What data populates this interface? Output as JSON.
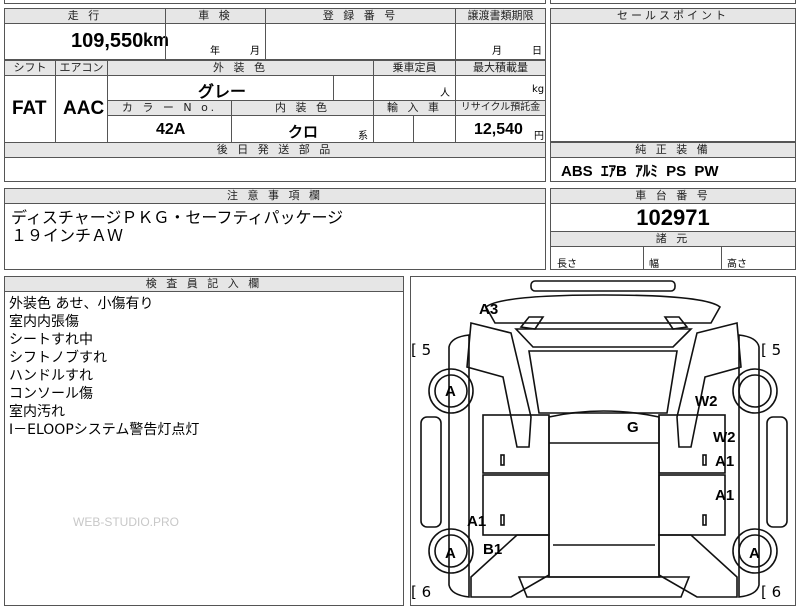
{
  "top_section": {
    "headers": {
      "mileage": "走 行",
      "inspection": "車 検",
      "registration": "登 録 番 号",
      "transfer_deadline": "譲渡書類期限",
      "sales_point": "セールスポイント"
    },
    "mileage_value": "109,550",
    "mileage_unit": "km",
    "inspection_year": "年",
    "inspection_month": "月",
    "transfer_month": "月",
    "transfer_day": "日"
  },
  "spec_section": {
    "headers": {
      "shift": "シフト",
      "aircon": "エアコン",
      "exterior_color": "外 装 色",
      "capacity": "乗車定員",
      "max_load": "最大積載量",
      "color_no": "カ ラ ー N o.",
      "interior_color": "内 装 色",
      "import": "輸 入 車",
      "recycle": "リサイクル預託金",
      "post_shipping": "後 日 発 送 部 品"
    },
    "shift_value": "FAT",
    "aircon_value": "AAC",
    "exterior_color_value": "グレー",
    "capacity_unit": "人",
    "max_load_unit": "kg",
    "color_no_value": "42A",
    "interior_color_value": "クロ",
    "interior_color_suffix": "系",
    "recycle_value": "12,540",
    "recycle_unit": "円"
  },
  "equipment": {
    "header": "純 正 装 備",
    "items": [
      "ABS",
      "ｴｱB",
      "ｱﾙﾐ",
      "PS",
      "PW"
    ]
  },
  "notes": {
    "header": "注 意 事 項 欄",
    "lines": [
      "ディスチャージＰＫＧ・セーフティパッケージ",
      "１９インチＡＷ"
    ]
  },
  "chassis": {
    "header": "車 台 番 号",
    "value": "102971",
    "dims_header": "諸 元",
    "length_label": "長さ",
    "width_label": "幅",
    "height_label": "高さ"
  },
  "inspector": {
    "header": "検 査 員 記 入 欄",
    "lines": [
      "外装色 あせ、小傷有り",
      "室内内張傷",
      "シートすれ中",
      "シフトノブすれ",
      "ハンドルすれ",
      "コンソール傷",
      "室内汚れ",
      "I－ELOOPシステム警告灯点灯"
    ]
  },
  "watermark": "WEB-STUDIO.PRO",
  "diagram": {
    "marks": {
      "a3": "A3",
      "g": "G",
      "w2_upper": "W2",
      "w2_lower": "W2",
      "a1_right_1": "A1",
      "a1_right_2": "A1",
      "a1_left": "A1",
      "b1": "B1",
      "a_tire_1": "A",
      "a_tire_2": "A",
      "a_tire_3": "A",
      "bracket_5_left": "[ 5",
      "bracket_5_right": "[ 5",
      "bracket_6_left": "[ 6",
      "bracket_6_right": "[ 6"
    }
  }
}
